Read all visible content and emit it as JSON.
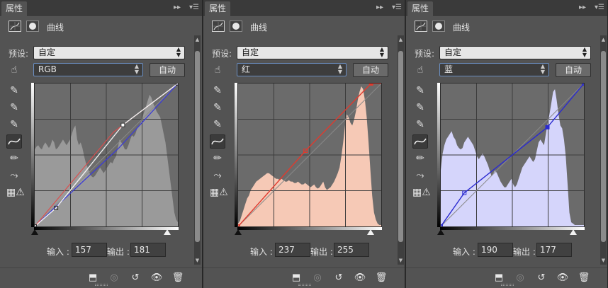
{
  "panels": [
    {
      "tab": "属性",
      "title": "曲线",
      "preset_label": "预设:",
      "preset_value": "自定",
      "channel": "RGB",
      "auto_label": "自动",
      "input_label": "输入 :",
      "input_value": "157",
      "output_label": "输出 :",
      "output_value": "181",
      "fill": "#9a9a9a",
      "curve_color": "#f2f2f2",
      "hist": [
        0.55,
        0.57,
        0.58,
        0.56,
        0.55,
        0.58,
        0.6,
        0.58,
        0.56,
        0.58,
        0.62,
        0.6,
        0.55,
        0.56,
        0.58,
        0.6,
        0.62,
        0.6,
        0.58,
        0.6,
        0.62,
        0.66,
        0.7,
        0.72,
        0.62,
        0.58,
        0.6,
        0.56,
        0.5,
        0.45,
        0.42,
        0.38,
        0.36,
        0.35,
        0.36,
        0.38,
        0.4,
        0.42,
        0.4,
        0.38,
        0.4,
        0.42,
        0.44,
        0.46,
        0.45,
        0.48,
        0.5,
        0.56,
        0.62,
        0.6,
        0.58,
        0.55,
        0.55,
        0.58,
        0.62,
        0.65,
        0.64,
        0.66,
        0.7,
        0.72,
        0.74,
        0.78,
        0.82,
        0.86,
        0.9,
        0.94,
        0.92,
        0.88,
        0.85,
        0.82,
        0.8,
        0.78,
        0.72,
        0.66,
        0.6,
        0.5,
        0.4,
        0.3,
        0.2,
        0.1,
        0.05,
        0.03
      ],
      "curve_pts": [
        [
          0,
          0
        ],
        [
          38,
          33
        ],
        [
          157,
          181
        ],
        [
          255,
          255
        ]
      ],
      "blue_line": true,
      "red_line": true
    },
    {
      "tab": "属性",
      "title": "曲线",
      "preset_label": "预设:",
      "preset_value": "自定",
      "channel": "红",
      "auto_label": "自动",
      "input_label": "输入 :",
      "input_value": "237",
      "output_label": "输出 :",
      "output_value": "255",
      "fill": "#f6c9b6",
      "curve_color": "#e03a2e",
      "hist": [
        0.02,
        0.04,
        0.08,
        0.12,
        0.16,
        0.2,
        0.22,
        0.26,
        0.28,
        0.3,
        0.32,
        0.33,
        0.34,
        0.35,
        0.36,
        0.37,
        0.38,
        0.38,
        0.37,
        0.36,
        0.35,
        0.34,
        0.34,
        0.33,
        0.34,
        0.33,
        0.32,
        0.32,
        0.33,
        0.32,
        0.32,
        0.31,
        0.31,
        0.32,
        0.31,
        0.3,
        0.3,
        0.31,
        0.3,
        0.29,
        0.28,
        0.29,
        0.3,
        0.28,
        0.27,
        0.28,
        0.3,
        0.32,
        0.28,
        0.26,
        0.27,
        0.28,
        0.3,
        0.32,
        0.35,
        0.38,
        0.42,
        0.5,
        0.6,
        0.72,
        0.8,
        0.78,
        0.74,
        0.72,
        0.76,
        0.82,
        0.9,
        0.96,
        1.0,
        0.98,
        0.9,
        0.78,
        0.6,
        0.4,
        0.22,
        0.1,
        0.05,
        0.02,
        0.01,
        0.01
      ],
      "curve_pts": [
        [
          0,
          0
        ],
        [
          120,
          135
        ],
        [
          237,
          255
        ]
      ],
      "blue_line": false,
      "red_line": false
    },
    {
      "tab": "属性",
      "title": "曲线",
      "preset_label": "预设:",
      "preset_value": "自定",
      "channel": "蓝",
      "auto_label": "自动",
      "input_label": "输入 :",
      "input_value": "190",
      "output_label": "输出 :",
      "output_value": "177",
      "fill": "#d5d5fb",
      "curve_color": "#2a2ad0",
      "hist": [
        0.4,
        0.52,
        0.58,
        0.62,
        0.64,
        0.66,
        0.68,
        0.64,
        0.62,
        0.58,
        0.56,
        0.55,
        0.56,
        0.6,
        0.62,
        0.64,
        0.62,
        0.6,
        0.58,
        0.54,
        0.5,
        0.48,
        0.5,
        0.52,
        0.5,
        0.47,
        0.44,
        0.4,
        0.36,
        0.38,
        0.4,
        0.38,
        0.35,
        0.32,
        0.3,
        0.28,
        0.28,
        0.3,
        0.32,
        0.34,
        0.3,
        0.28,
        0.3,
        0.34,
        0.38,
        0.42,
        0.44,
        0.46,
        0.48,
        0.5,
        0.48,
        0.46,
        0.48,
        0.54,
        0.6,
        0.62,
        0.6,
        0.58,
        0.66,
        0.74,
        0.8,
        0.88,
        0.96,
        0.98,
        0.9,
        0.8,
        0.72,
        0.7,
        0.62,
        0.5,
        0.3,
        0.1,
        0.03,
        0.02,
        0.01,
        0.01,
        0.01,
        0.01,
        0.01,
        0.01
      ],
      "curve_pts": [
        [
          0,
          0
        ],
        [
          42,
          60
        ],
        [
          190,
          177
        ],
        [
          255,
          255
        ]
      ],
      "blue_line": false,
      "red_line": false
    }
  ]
}
